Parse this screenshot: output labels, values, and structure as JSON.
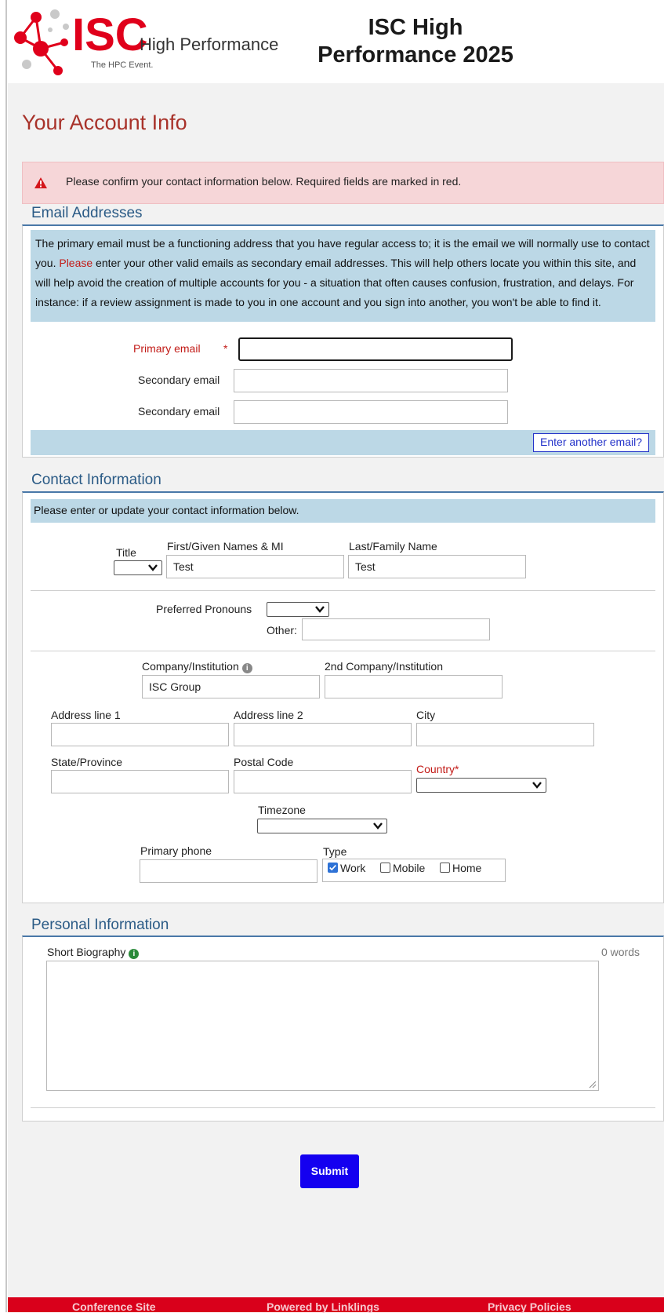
{
  "header": {
    "logo_text": "ISC",
    "logo_subtext": "High Performance",
    "logo_tagline": "The HPC Event.",
    "site_title_line1": "ISC High",
    "site_title_line2": "Performance 2025"
  },
  "page_title": "Your Account Info",
  "alert": {
    "text": "Please confirm your contact information below. Required fields are marked in red."
  },
  "email_section": {
    "title": "Email Addresses",
    "info_pre": "The primary email must be a functioning address that you have regular access to; it is the email we will normally use to contact you. ",
    "info_red": "Please",
    "info_post": " enter your other valid emails as secondary email addresses. This will help others locate you within this site, and will help avoid the creation of multiple accounts for you - a situation that often causes confusion, frustration, and delays. For instance: if a review assignment is made to you in one account and you sign into another, you won't be able to find it.",
    "primary_label": "Primary email",
    "required_marker": "*",
    "primary_value": "",
    "secondary_label_1": "Secondary email",
    "secondary_label_2": "Secondary email",
    "secondary_value_1": "",
    "secondary_value_2": "",
    "enter_another": "Enter another email?"
  },
  "contact_section": {
    "title": "Contact Information",
    "info": "Please enter or update your contact information below.",
    "title_label": "Title",
    "title_value": "",
    "first_label": "First/Given Names & MI",
    "first_value": "Test",
    "last_label": "Last/Family Name",
    "last_value": "Test",
    "pronouns_label": "Preferred Pronouns",
    "pronouns_value": "",
    "other_label": "Other:",
    "other_value": "",
    "company_label": "Company/Institution",
    "company_value": "ISC Group",
    "company2_label": "2nd Company/Institution",
    "company2_value": "",
    "address1_label": "Address line 1",
    "address2_label": "Address line 2",
    "city_label": "City",
    "state_label": "State/Province",
    "postal_label": "Postal Code",
    "country_label": "Country*",
    "timezone_label": "Timezone",
    "phone_label": "Primary phone",
    "type_label": "Type",
    "type_options": [
      "Work",
      "Mobile",
      "Home"
    ],
    "type_checked": "Work"
  },
  "personal_section": {
    "title": "Personal Information",
    "bio_label": "Short Biography",
    "word_count": "0 words",
    "bio_value": ""
  },
  "submit_label": "Submit",
  "footer": {
    "links": [
      "Conference Site",
      "Powered by Linklings",
      "Privacy Policies"
    ]
  },
  "colors": {
    "brand_red": "#d9001b",
    "title_red": "#a8322a",
    "section_blue": "#2b5b86",
    "info_bg": "#bcd8e6",
    "submit_blue": "#1400f0"
  }
}
